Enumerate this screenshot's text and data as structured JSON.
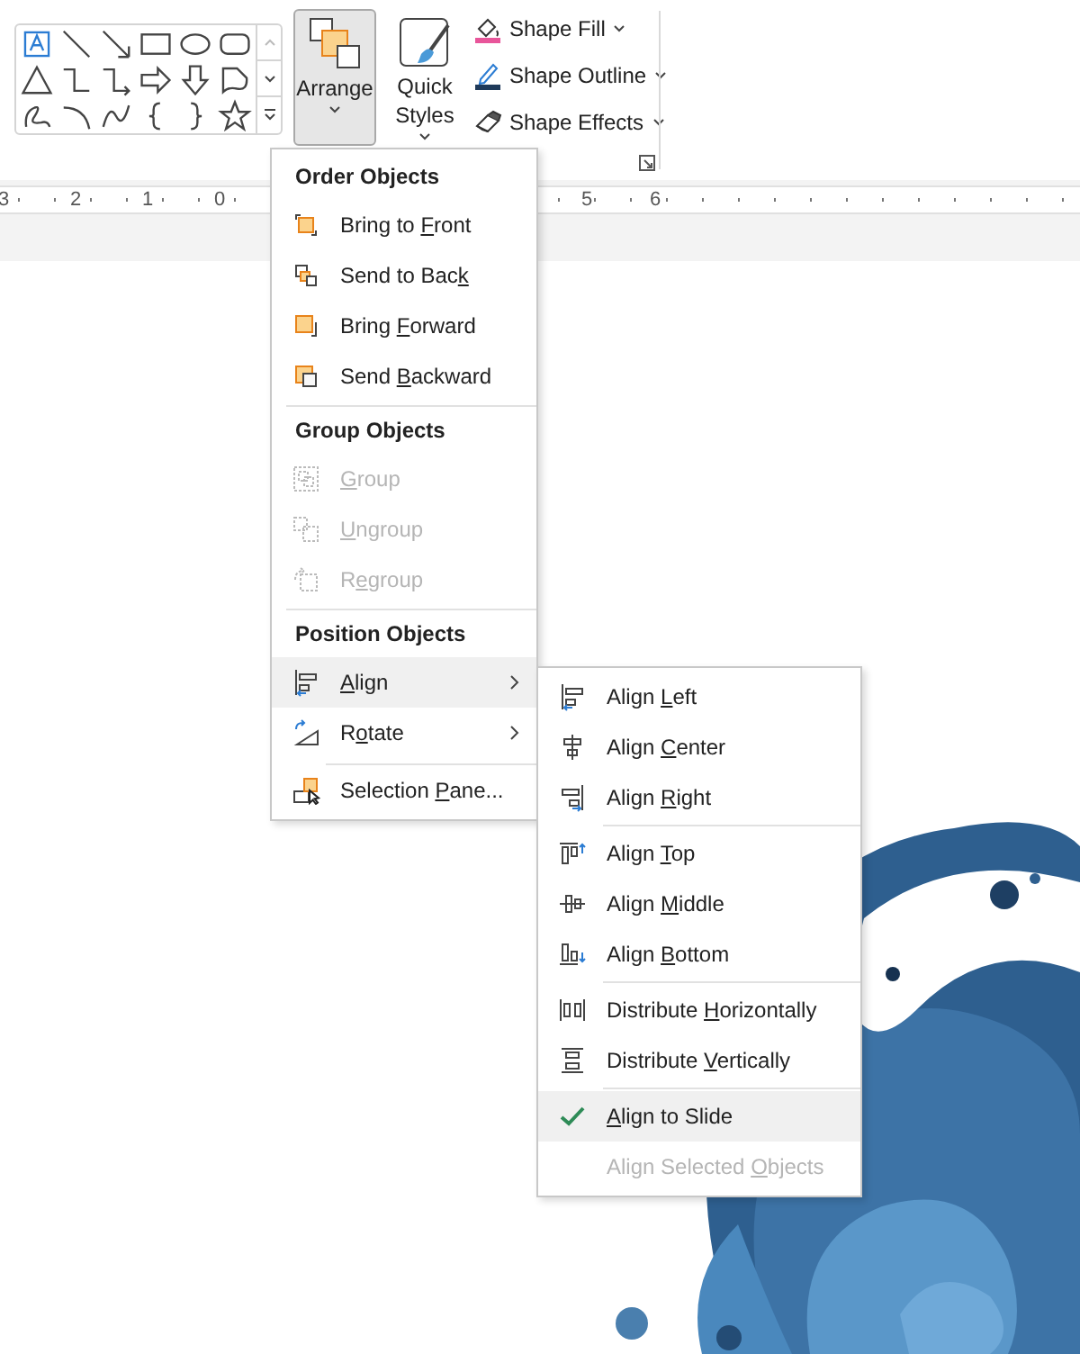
{
  "ribbon": {
    "arrange": {
      "label": "Arrange",
      "pressed": true
    },
    "quick_styles": {
      "label": "Quick Styles"
    },
    "format_buttons": [
      {
        "label": "Shape Fill"
      },
      {
        "label": "Shape Outline"
      },
      {
        "label": "Shape Effects"
      }
    ]
  },
  "ruler": {
    "labels": [
      "3",
      "2",
      "1",
      "0",
      "5",
      "6"
    ]
  },
  "arrange_menu": {
    "sections": [
      {
        "header": "Order Objects",
        "items": [
          {
            "pre": "Bring to ",
            "key": "F",
            "post": "ront",
            "disabled": false,
            "kind": "item",
            "expanded": false
          },
          {
            "pre": "Send to Bac",
            "key": "k",
            "disabled": false,
            "kind": "item",
            "expanded": false
          },
          {
            "pre": "Bring ",
            "key": "F",
            "post": "orward",
            "disabled": false,
            "kind": "item",
            "expanded": false
          },
          {
            "pre": "Send ",
            "key": "B",
            "post": "ackward",
            "disabled": false,
            "kind": "item",
            "expanded": false
          }
        ]
      },
      {
        "header": "Group Objects",
        "items": [
          {
            "key": "G",
            "post": "roup",
            "disabled": true,
            "kind": "item",
            "expanded": false
          },
          {
            "key": "U",
            "post": "ngroup",
            "disabled": true,
            "kind": "item",
            "expanded": false
          },
          {
            "pre": "R",
            "key": "e",
            "post": "group",
            "disabled": true,
            "kind": "item",
            "expanded": false
          }
        ]
      },
      {
        "header": "Position Objects",
        "items": [
          {
            "key": "A",
            "post": "lign",
            "disabled": false,
            "kind": "submenu",
            "expanded": true
          },
          {
            "pre": "R",
            "key": "o",
            "post": "tate",
            "disabled": false,
            "kind": "submenu",
            "expanded": false
          },
          {
            "pre": "Selection ",
            "key": "P",
            "post": "ane...",
            "disabled": false,
            "kind": "item",
            "expanded": false
          }
        ]
      }
    ]
  },
  "align_menu": {
    "groups": [
      [
        {
          "pre": "Align ",
          "key": "L",
          "post": "eft",
          "disabled": false,
          "checked": false,
          "selected": false
        },
        {
          "pre": "Align ",
          "key": "C",
          "post": "enter",
          "disabled": false,
          "checked": false,
          "selected": false
        },
        {
          "pre": "Align ",
          "key": "R",
          "post": "ight",
          "disabled": false,
          "checked": false,
          "selected": false
        }
      ],
      [
        {
          "pre": "Align ",
          "key": "T",
          "post": "op",
          "disabled": false,
          "checked": false,
          "selected": false
        },
        {
          "pre": "Align ",
          "key": "M",
          "post": "iddle",
          "disabled": false,
          "checked": false,
          "selected": false
        },
        {
          "pre": "Align ",
          "key": "B",
          "post": "ottom",
          "disabled": false,
          "checked": false,
          "selected": false
        }
      ],
      [
        {
          "pre": "Distribute ",
          "key": "H",
          "post": "orizontally",
          "disabled": false,
          "checked": false,
          "selected": false
        },
        {
          "pre": "Distribute ",
          "key": "V",
          "post": "ertically",
          "disabled": false,
          "checked": false,
          "selected": false
        }
      ],
      [
        {
          "key": "A",
          "post": "lign to Slide",
          "disabled": false,
          "checked": true,
          "selected": true
        },
        {
          "pre": "Align Selected ",
          "key": "O",
          "post": "bjects",
          "disabled": true,
          "checked": false,
          "selected": false
        }
      ]
    ]
  }
}
